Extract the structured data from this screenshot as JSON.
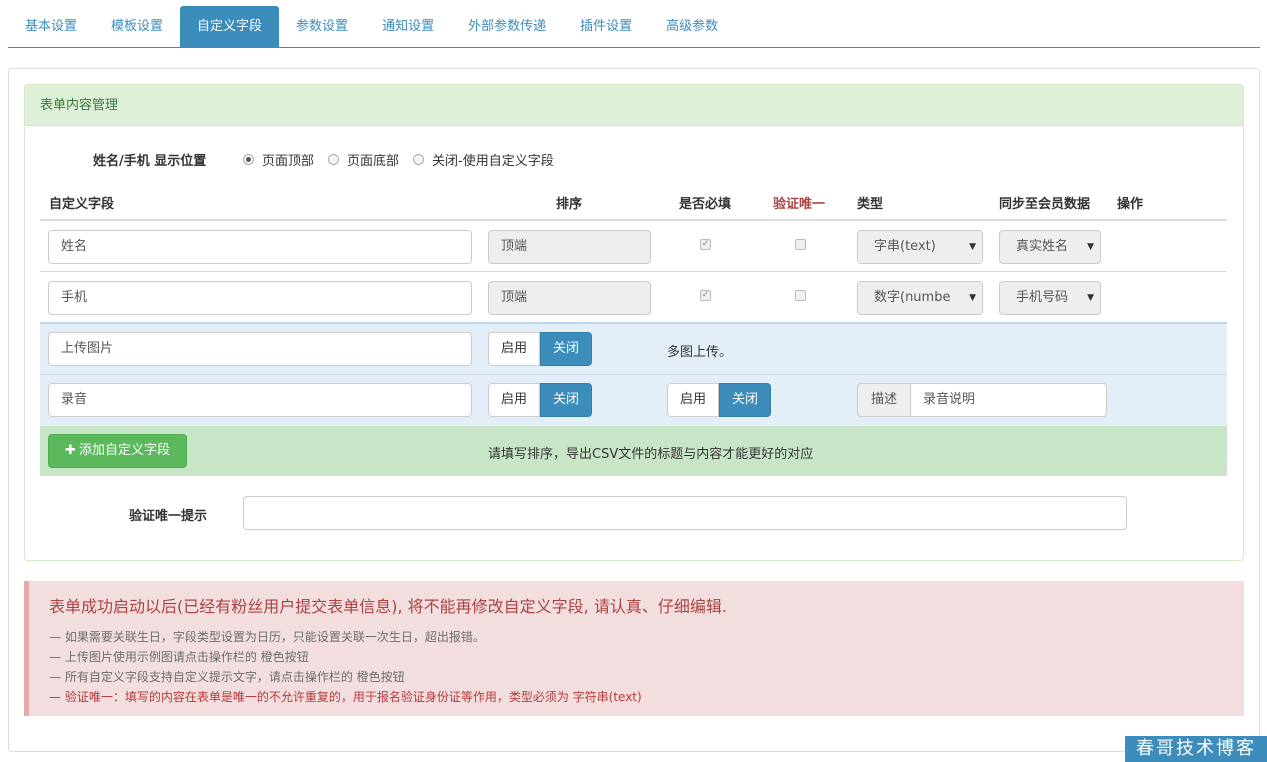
{
  "tabs": [
    "基本设置",
    "模板设置",
    "自定义字段",
    "参数设置",
    "通知设置",
    "外部参数传递",
    "插件设置",
    "高级参数"
  ],
  "active_tab": "自定义字段",
  "panel": {
    "heading": "表单内容管理",
    "name_phone_label": "姓名/手机 显示位置",
    "position_options": [
      "页面顶部",
      "页面底部",
      "关闭-使用自定义字段"
    ],
    "position_selected": "页面顶部"
  },
  "columns": {
    "field": "自定义字段",
    "order": "排序",
    "required": "是否必填",
    "unique": "验证唯一",
    "type": "类型",
    "sync": "同步至会员数据",
    "action": "操作"
  },
  "rows": {
    "name": {
      "value": "姓名",
      "order": "顶端",
      "required": true,
      "unique": false,
      "type": "字串(text)",
      "sync": "真实姓名"
    },
    "phone": {
      "value": "手机",
      "order": "顶端",
      "required": true,
      "unique": false,
      "type": "数字(numbe",
      "sync": "手机号码"
    },
    "upload": {
      "value": "上传图片",
      "on_label": "启用",
      "off_label": "关闭",
      "note": "多图上传。"
    },
    "audio": {
      "value": "录音",
      "on_label": "启用",
      "off_label": "关闭",
      "on2_label": "启用",
      "off2_label": "关闭",
      "desc_label": "描述",
      "desc_value": "录音说明"
    }
  },
  "add_button": "添加自定义字段",
  "add_hint": "请填写排序，导出CSV文件的标题与内容才能更好的对应",
  "unique_hint_label": "验证唯一提示",
  "unique_hint_value": "",
  "alert": {
    "title": "表单成功启动以后(已经有粉丝用户提交表单信息), 将不能再修改自定义字段, 请认真、仔细编辑.",
    "lines": [
      "— 如果需要关联生日，字段类型设置为日历，只能设置关联一次生日，超出报错。",
      "— 上传图片使用示例图请点击操作栏的 橙色按钮",
      "— 所有自定义字段支持自定义提示文字，请点击操作栏的 橙色按钮",
      "— 验证唯一：填写的内容在表单是唯一的不允许重复的，用于报名验证身份证等作用，类型必须为 字符串(text)"
    ]
  },
  "watermark": "春哥技术博客",
  "colors": {
    "primary": "#3c8dbc",
    "success": "#5cb85c",
    "danger_text": "#a94442",
    "panel_heading": "#dff0d8"
  }
}
